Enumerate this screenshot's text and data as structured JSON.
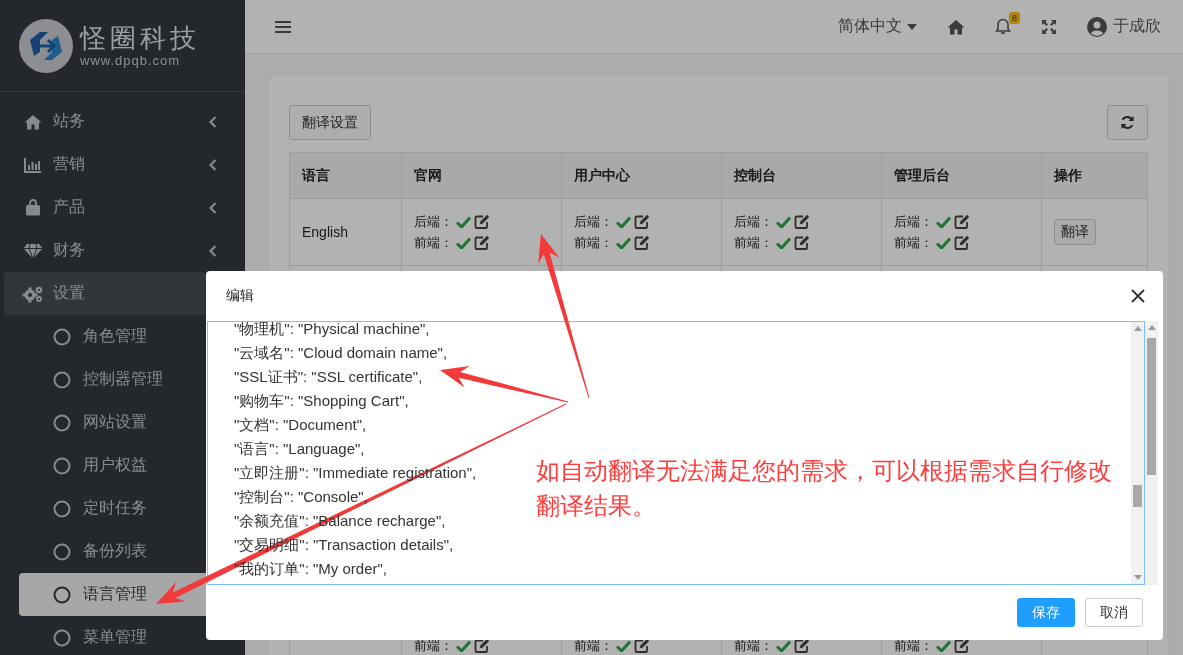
{
  "sidebar": {
    "logo": {
      "name": "怪圈科技",
      "url": "www.dpqb.com"
    },
    "items": [
      {
        "label": "站务",
        "selected": false
      },
      {
        "label": "营销",
        "selected": false
      },
      {
        "label": "产品",
        "selected": false
      },
      {
        "label": "财务",
        "selected": false
      },
      {
        "label": "设置",
        "selected": false,
        "children": [
          {
            "label": "角色管理",
            "selected": false
          },
          {
            "label": "控制器管理",
            "selected": false
          },
          {
            "label": "网站设置",
            "selected": false
          },
          {
            "label": "用户权益",
            "selected": false
          },
          {
            "label": "定时任务",
            "selected": false
          },
          {
            "label": "备份列表",
            "selected": false
          },
          {
            "label": "语言管理",
            "selected": true
          },
          {
            "label": "菜单管理",
            "selected": false
          }
        ]
      }
    ]
  },
  "header": {
    "language": "简体中文",
    "notifications": "8",
    "user": "于成欣"
  },
  "toolbar": {
    "settings_button": "翻译设置"
  },
  "table": {
    "columns": [
      "语言",
      "官网",
      "用户中心",
      "控制台",
      "管理后台",
      "操作"
    ],
    "rows": [
      {
        "cells": [
          {
            "kind": "text",
            "text": "English"
          },
          {
            "kind": "status",
            "backend_label": "后端：",
            "backend_done": true,
            "frontend_label": "前端：",
            "frontend_done": true
          },
          {
            "kind": "status",
            "backend_label": "后端：",
            "backend_done": true,
            "frontend_label": "前端：",
            "frontend_done": true
          },
          {
            "kind": "status",
            "backend_label": "后端：",
            "backend_done": true,
            "frontend_label": "前端：",
            "frontend_done": true
          },
          {
            "kind": "status",
            "backend_label": "后端：",
            "backend_done": true,
            "frontend_label": "前端：",
            "frontend_done": true
          },
          {
            "kind": "action",
            "label": "翻译"
          }
        ]
      },
      {
        "cells": [
          {
            "kind": "blank"
          },
          {
            "kind": "status",
            "frontend_label": "前端：",
            "frontend_done": true
          },
          {
            "kind": "status",
            "frontend_label": "前端：",
            "frontend_done": true
          },
          {
            "kind": "status",
            "frontend_label": "前端：",
            "frontend_done": true
          },
          {
            "kind": "status",
            "frontend_label": "前端：",
            "frontend_done": true
          },
          {
            "kind": "blank"
          }
        ]
      }
    ]
  },
  "modal": {
    "title": "编辑",
    "lines": [
      "\"物理机\": \"Physical machine\",",
      "\"云域名\": \"Cloud domain name\",",
      "\"SSL证书\": \"SSL certificate\",",
      "\"购物车\": \"Shopping Cart\",",
      "\"文档\": \"Document\",",
      "\"语言\": \"Language\",",
      "\"立即注册\": \"Immediate registration\",",
      "\"控制台\": \"Console\",",
      "\"余额充值\": \"Balance recharge\",",
      "\"交易明细\": \"Transaction details\",",
      "\"我的订单\": \"My order\","
    ],
    "buttons": [
      {
        "label": "保存",
        "kind": "primary"
      },
      {
        "label": "取消",
        "kind": "default"
      }
    ]
  },
  "annotation": {
    "note": "如自动翻译无法满足您的需求，可以根据需求自行修改翻译结果。"
  }
}
